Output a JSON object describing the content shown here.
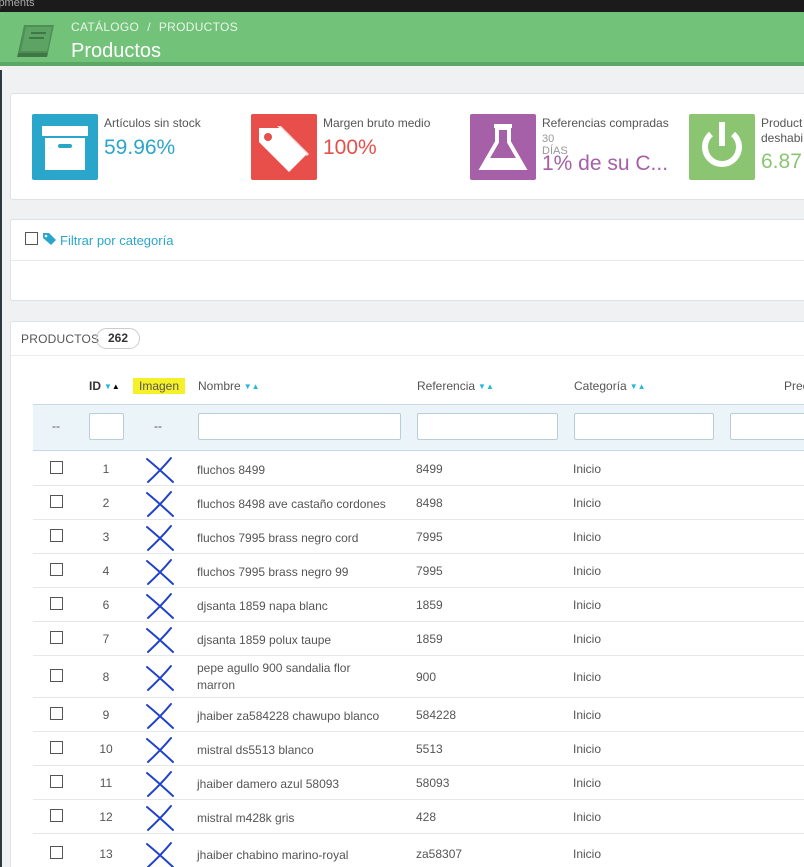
{
  "os_bar": {
    "text": "ipments"
  },
  "header": {
    "breadcrumb": [
      "CATÁLOGO",
      "PRODUCTOS"
    ],
    "breadcrumb_sep": "/",
    "title": "Productos",
    "logo_icon": "book-icon",
    "color": "#72c279"
  },
  "kpis": [
    {
      "label": "Artículos sin stock",
      "sub": "",
      "value": "59.96%",
      "color": "#2ba6cb",
      "box_color": "#2ba6cb",
      "icon": "archive-box-icon"
    },
    {
      "label": "Margen bruto medio",
      "sub": "",
      "value": "100%",
      "color": "#e84e4a",
      "box_color": "#e84e4a",
      "icon": "price-tag-icon"
    },
    {
      "label": "Referencias compradas",
      "sub": "30 DÍAS",
      "value": "1% de su C...",
      "color": "#a560a8",
      "box_color": "#a560a8",
      "icon": "flask-icon"
    },
    {
      "label": "Product",
      "label2": "deshabi",
      "sub": "",
      "value": "6.87",
      "color": "#8bc572",
      "box_color": "#8bc572",
      "icon": "power-icon"
    }
  ],
  "filter": {
    "label": "Filtrar por categoría",
    "icon": "tag-icon"
  },
  "products": {
    "title": "PRODUCTOS",
    "count": "262",
    "columns": {
      "id": "ID",
      "image": "Imagen",
      "name": "Nombre",
      "reference": "Referencia",
      "category": "Categoría",
      "price": "Prec"
    },
    "filter_dash": "--",
    "rows": [
      {
        "id": "1",
        "name": "fluchos 8499",
        "ref": "8499",
        "cat": "Inicio"
      },
      {
        "id": "2",
        "name": "fluchos 8498 ave castaño cordones",
        "ref": "8498",
        "cat": "Inicio"
      },
      {
        "id": "3",
        "name": "fluchos 7995 brass negro cord",
        "ref": "7995",
        "cat": "Inicio"
      },
      {
        "id": "4",
        "name": "fluchos 7995 brass negro 99",
        "ref": "7995",
        "cat": "Inicio"
      },
      {
        "id": "6",
        "name": "djsanta 1859 napa blanc",
        "ref": "1859",
        "cat": "Inicio"
      },
      {
        "id": "7",
        "name": "djsanta 1859 polux taupe",
        "ref": "1859",
        "cat": "Inicio"
      },
      {
        "id": "8",
        "name": "pepe agullo 900 sandalia flor",
        "name2": "marron",
        "ref": "900",
        "cat": "Inicio"
      },
      {
        "id": "9",
        "name": "jhaiber za584228 chawupo blanco",
        "ref": "584228",
        "cat": "Inicio"
      },
      {
        "id": "10",
        "name": "mistral ds5513 blanco",
        "ref": "5513",
        "cat": "Inicio"
      },
      {
        "id": "11",
        "name": "jhaiber damero azul 58093",
        "ref": "58093",
        "cat": "Inicio"
      },
      {
        "id": "12",
        "name": "mistral m428k gris",
        "ref": "428",
        "cat": "Inicio"
      },
      {
        "id": "13",
        "name": "jhaiber chabino marino-royal",
        "ref": "za58307",
        "cat": "Inicio"
      }
    ]
  }
}
